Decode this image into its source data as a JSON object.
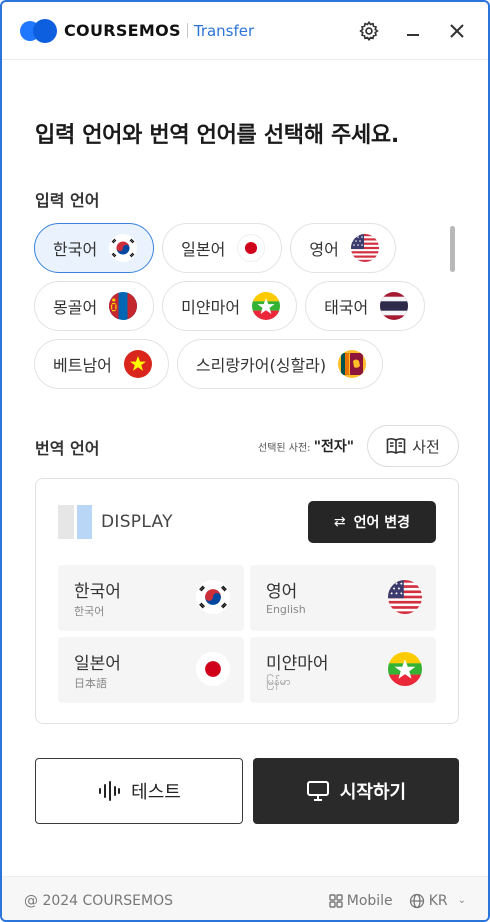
{
  "app": {
    "brand": "COURSEMOS",
    "product": "Transfer"
  },
  "headline": "입력 언어와 번역 언어를 선택해 주세요.",
  "input_section": {
    "label": "입력 언어",
    "languages": [
      {
        "label": "한국어",
        "flag": "korea-flag-icon",
        "selected": true
      },
      {
        "label": "일본어",
        "flag": "japan-flag-icon",
        "selected": false
      },
      {
        "label": "영어",
        "flag": "usa-flag-icon",
        "selected": false
      },
      {
        "label": "몽골어",
        "flag": "mongolia-flag-icon",
        "selected": false
      },
      {
        "label": "미얀마어",
        "flag": "myanmar-flag-icon",
        "selected": false
      },
      {
        "label": "태국어",
        "flag": "thailand-flag-icon",
        "selected": false
      },
      {
        "label": "베트남어",
        "flag": "vietnam-flag-icon",
        "selected": false
      },
      {
        "label": "스리랑카어(싱할라)",
        "flag": "sri-lanka-flag-icon",
        "selected": false
      }
    ]
  },
  "target_section": {
    "label": "번역 언어",
    "dict_prefix": "선택된 사전:",
    "dict_value": "\"전자\"",
    "dict_button": "사전",
    "display_title": "DISPLAY",
    "swap_button": "언어 변경",
    "cards": [
      {
        "name": "한국어",
        "sub": "한국어",
        "flag": "korea-flag-icon"
      },
      {
        "name": "영어",
        "sub": "English",
        "flag": "usa-flag-icon"
      },
      {
        "name": "일본어",
        "sub": "日本語",
        "flag": "japan-flag-icon"
      },
      {
        "name": "미얀마어",
        "sub": "မြန်မာ",
        "flag": "myanmar-flag-icon"
      }
    ]
  },
  "actions": {
    "test_label": "테스트",
    "start_label": "시작하기"
  },
  "footer": {
    "copyright": "@ 2024 COURSEMOS",
    "mobile": "Mobile",
    "lang": "KR"
  },
  "colors": {
    "accent": "#2b74d9",
    "selected_bg": "#eaf3fd",
    "dark_button": "#2a2a2a"
  }
}
